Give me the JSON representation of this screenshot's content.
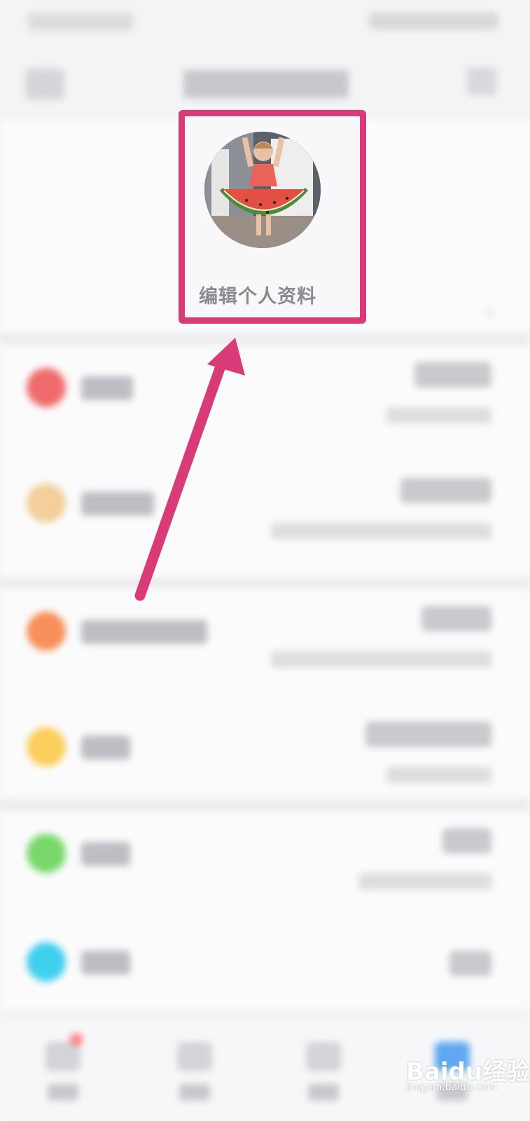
{
  "profile": {
    "edit_label": "编辑个人资料"
  },
  "colors": {
    "highlight": "#d93b79",
    "row_icons": [
      "#f06b6b",
      "#f3cf9a",
      "#f7905a",
      "#fbcf5c",
      "#78d86a",
      "#3fd0f0"
    ]
  },
  "icons": {
    "header_left": "menu-icon",
    "header_right": "settings-icon",
    "chevron": "chevron-right-icon"
  },
  "watermark": {
    "text": "Baidu经验",
    "url": "jingyan.baidu.com"
  }
}
